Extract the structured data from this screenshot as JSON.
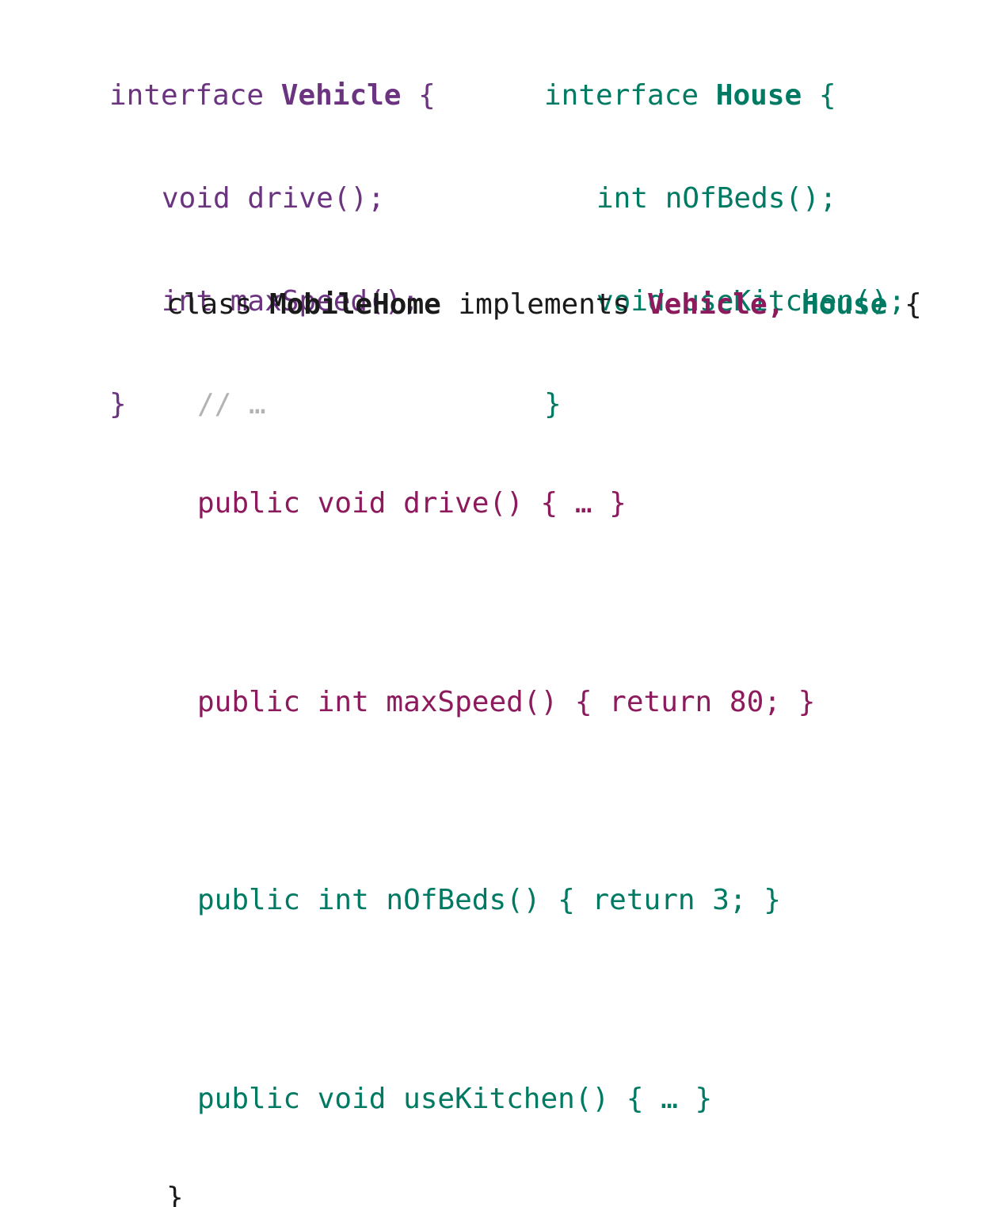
{
  "colors": {
    "vehicle": "#6b3380",
    "house": "#007a63",
    "class_text": "#1a1a1a",
    "vehicle_impl": "#8c1a5c",
    "comment": "#b3b3b3"
  },
  "vehicle_interface": {
    "keyword": "interface",
    "name": "Vehicle",
    "open_brace": "{",
    "methods": [
      {
        "return_type": "void",
        "signature": "drive();"
      },
      {
        "return_type": "int",
        "signature": "maxSpeed();"
      }
    ],
    "close_brace": "}"
  },
  "house_interface": {
    "keyword": "interface",
    "name": "House",
    "open_brace": "{",
    "methods": [
      {
        "return_type": "int",
        "signature": "nOfBeds();"
      },
      {
        "return_type": "void",
        "signature": "useKitchen();"
      }
    ],
    "close_brace": "}"
  },
  "mobilehome_class": {
    "keyword": "class",
    "name": "MobileHome",
    "implements_keyword": "implements",
    "interface_1": "Vehicle,",
    "interface_2": "House",
    "open_brace": "{",
    "comment": "// …",
    "methods": [
      {
        "text": "public void drive() { … }"
      },
      {
        "text": "public int maxSpeed() { return 80; }"
      },
      {
        "text": "public int nOfBeds() { return 3; }"
      },
      {
        "text": "public void useKitchen() { … }"
      }
    ],
    "close_brace": "}"
  }
}
